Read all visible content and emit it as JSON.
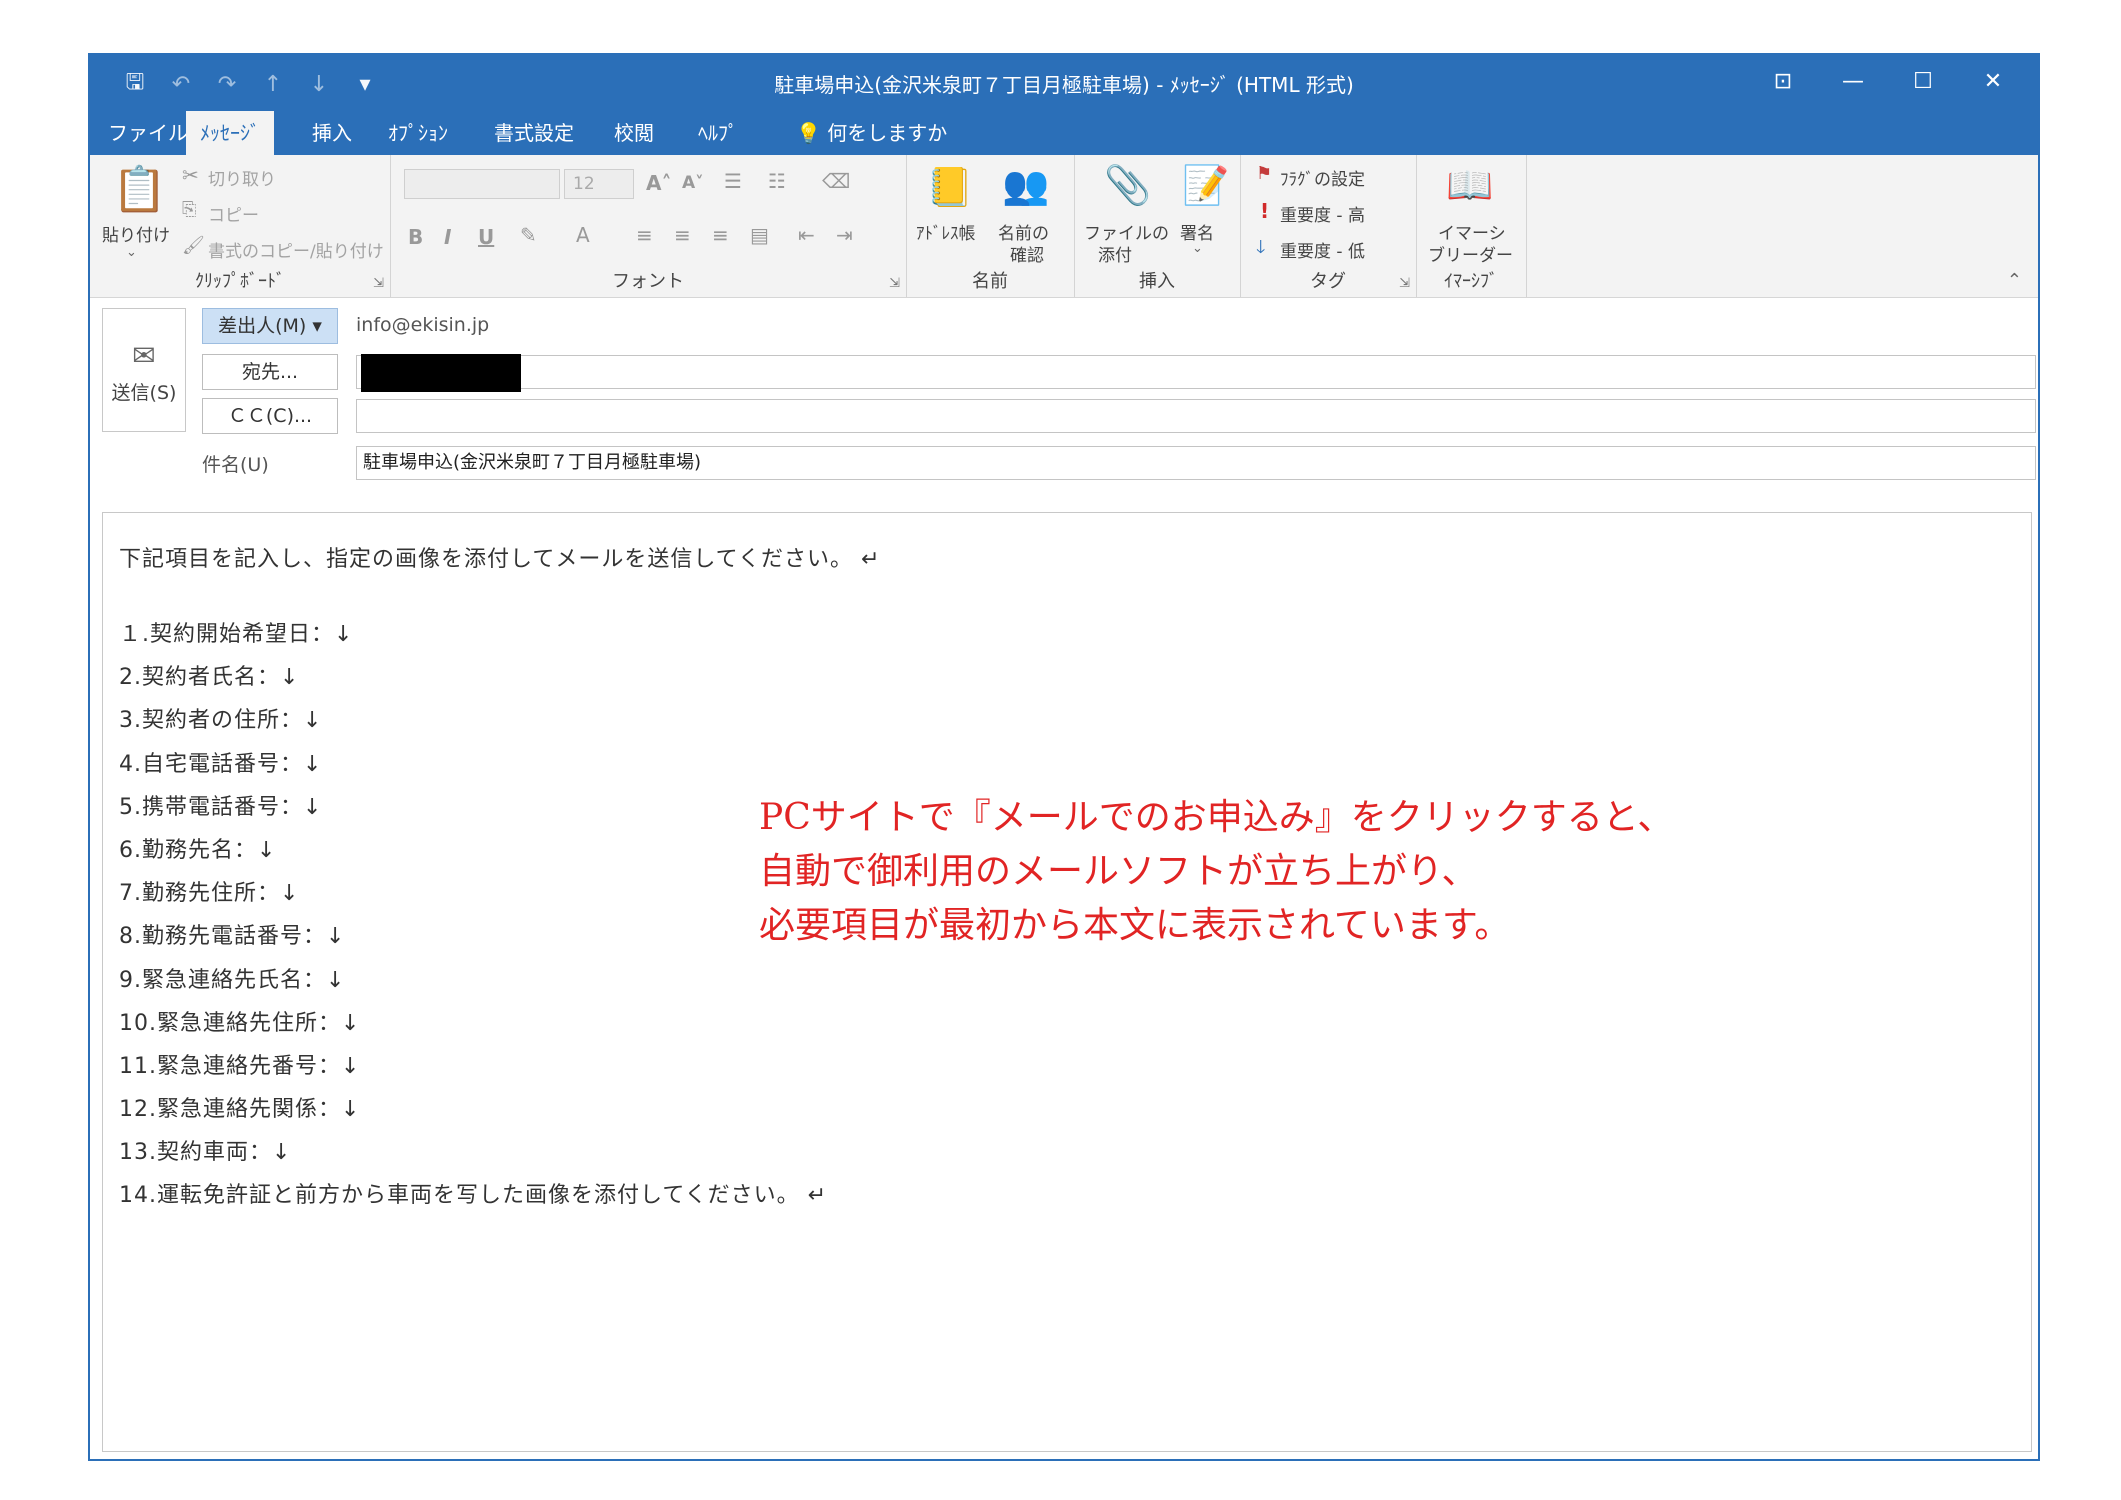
{
  "window": {
    "title": "駐車場申込(金沢米泉町７丁目月極駐車場) - ﾒｯｾｰｼﾞ (HTML 形式)",
    "qat_icons": [
      "save-icon",
      "undo-icon",
      "redo-icon",
      "up-arrow-icon",
      "down-arrow-icon",
      "customize-qat-icon"
    ],
    "controls": {
      "ribbon_display": "⊡",
      "minimize": "—",
      "maximize": "☐",
      "close": "✕"
    }
  },
  "menu": {
    "tabs": [
      "ファイル",
      "ﾒｯｾｰｼﾞ",
      "挿入",
      "ｵﾌﾟｼｮﾝ",
      "書式設定",
      "校閲",
      "ﾍﾙﾌﾟ"
    ],
    "active_index": 1,
    "tell_me": "何をしますか"
  },
  "ribbon": {
    "clipboard": {
      "label": "ｸﾘｯﾌﾟﾎﾞｰﾄﾞ",
      "paste": "貼り付け",
      "cut": "切り取り",
      "copy": "コピー",
      "format_painter": "書式のコピー/貼り付け"
    },
    "font": {
      "label": "フォント",
      "font_size": "12",
      "bold": "B",
      "italic": "I",
      "underline": "U"
    },
    "names": {
      "label": "名前",
      "address_book": "ｱﾄﾞﾚｽ帳",
      "check_names_1": "名前の",
      "check_names_2": "確認"
    },
    "insert": {
      "label": "挿入",
      "attach_1": "ファイルの",
      "attach_2": "添付",
      "signature": "署名"
    },
    "tags": {
      "label": "タグ",
      "flag": "ﾌﾗｸﾞの設定",
      "high": "重要度 - 高",
      "low": "重要度 - 低"
    },
    "immersive": {
      "label": "ｲﾏｰｼﾌﾞ",
      "reader_1": "イマーシ",
      "reader_2": "ブリーダー"
    }
  },
  "header": {
    "send_label": "送信(S)",
    "from_label": "差出人(M) ▾",
    "from_value": "info@ekisin.jp",
    "to_label": "宛先...",
    "cc_label": "ＣＣ(C)...",
    "subject_label": "件名(U)",
    "subject_value": "駐車場申込(金沢米泉町７丁目月極駐車場)"
  },
  "body": {
    "intro": "下記項目を記入し、指定の画像を添付してメールを送信してください。 ↵",
    "items": [
      "１.契約開始希望日：↓",
      "2.契約者氏名：↓",
      "3.契約者の住所：↓",
      "4.自宅電話番号：↓",
      "5.携帯電話番号：↓",
      "6.勤務先名：↓",
      "7.勤務先住所：↓",
      "8.勤務先電話番号：↓",
      "9.緊急連絡先氏名：↓",
      "10.緊急連絡先住所：↓",
      "11.緊急連絡先番号：↓",
      "12.緊急連絡先関係：↓",
      "13.契約車両：↓",
      "14.運転免許証と前方から車両を写した画像を添付してください。 ↵"
    ]
  },
  "annotation": {
    "lines": [
      "PCサイトで『メールでのお申込み』をクリックすると、",
      "自動で御利用のメールソフトが立ち上がり、",
      "必要項目が最初から本文に表示されています。"
    ],
    "color": "#e12424"
  },
  "colors": {
    "accent": "#2b6fb8",
    "ribbon_bg": "#f3f3f3"
  }
}
